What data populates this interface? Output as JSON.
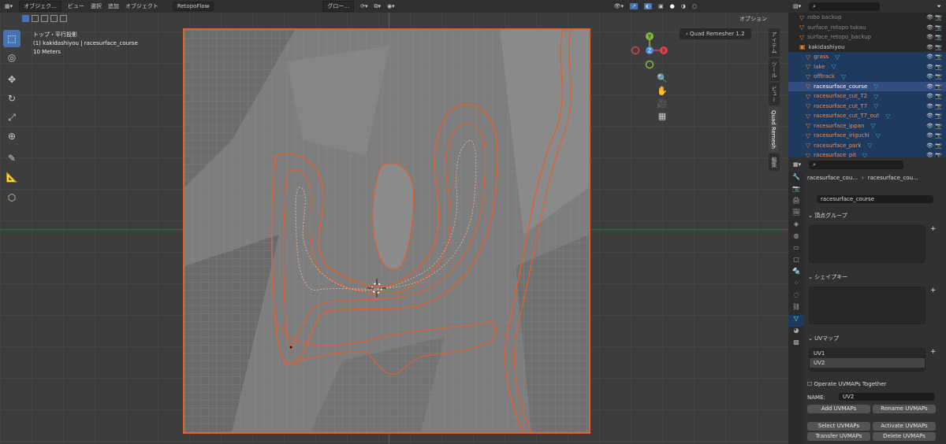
{
  "header": {
    "mode": "オブジェク...",
    "menu": [
      "ビュー",
      "選択",
      "追加",
      "オブジェクト"
    ],
    "addon": "RetopoFlow",
    "orient": "グロー...",
    "options": "オプション"
  },
  "overlay_info": {
    "line1": "トップ・平行投影",
    "line2": "(1) kakidashiyou | racesurface_course",
    "line3": "10 Meters"
  },
  "npanel": {
    "quad_remesher": "Quad Remesher 1.2",
    "tabs": [
      "Quad Remesh",
      "ビュー",
      "ツール",
      "アイテム"
    ],
    "side_tab": "編集"
  },
  "outliner": {
    "rows": [
      {
        "name": "robo backup",
        "type": "dim"
      },
      {
        "name": "surface_retopo tukau",
        "type": "dim"
      },
      {
        "name": "surface_retopo_backup",
        "type": "dim"
      },
      {
        "name": "kakidashiyou",
        "type": "coll"
      },
      {
        "name": "grass",
        "type": "sel"
      },
      {
        "name": "lake",
        "type": "sel"
      },
      {
        "name": "offtrack",
        "type": "sel"
      },
      {
        "name": "racesurface_course",
        "type": "act"
      },
      {
        "name": "racesurface_cut_T2",
        "type": "sel"
      },
      {
        "name": "racesurface_cut_T7",
        "type": "sel"
      },
      {
        "name": "racesurface_cut_T7_out",
        "type": "sel"
      },
      {
        "name": "racesurface_ippan",
        "type": "sel"
      },
      {
        "name": "racesurface_iriguchi",
        "type": "sel"
      },
      {
        "name": "racesurface_park",
        "type": "sel"
      },
      {
        "name": "racesurface_pit",
        "type": "sel"
      }
    ]
  },
  "props": {
    "breadcrumb_obj": "racesurface_cou...",
    "breadcrumb_mesh": "racesurface_cou...",
    "mesh_name": "racesurface_course",
    "vertex_groups": "頂点グループ",
    "shape_keys": "シェイプキー",
    "uv_maps": "UVマップ",
    "uv_list": [
      "UV1",
      "UV2"
    ],
    "operate_together": "Operate UVMAPs Together",
    "name_label": "NAME:",
    "name_value": "UV2",
    "buttons": [
      "Add UVMAPs",
      "Rename UVMAPs",
      "Select UVMAPs",
      "Activate UVMAPs",
      "Transfer UVMAPs",
      "Delete UVMAPs"
    ]
  },
  "colors": {
    "selection": "#e06030",
    "accent": "#4772b3",
    "x_axis": "#d9434a",
    "y_axis": "#7fb83c",
    "z_axis": "#4a8bd6"
  }
}
